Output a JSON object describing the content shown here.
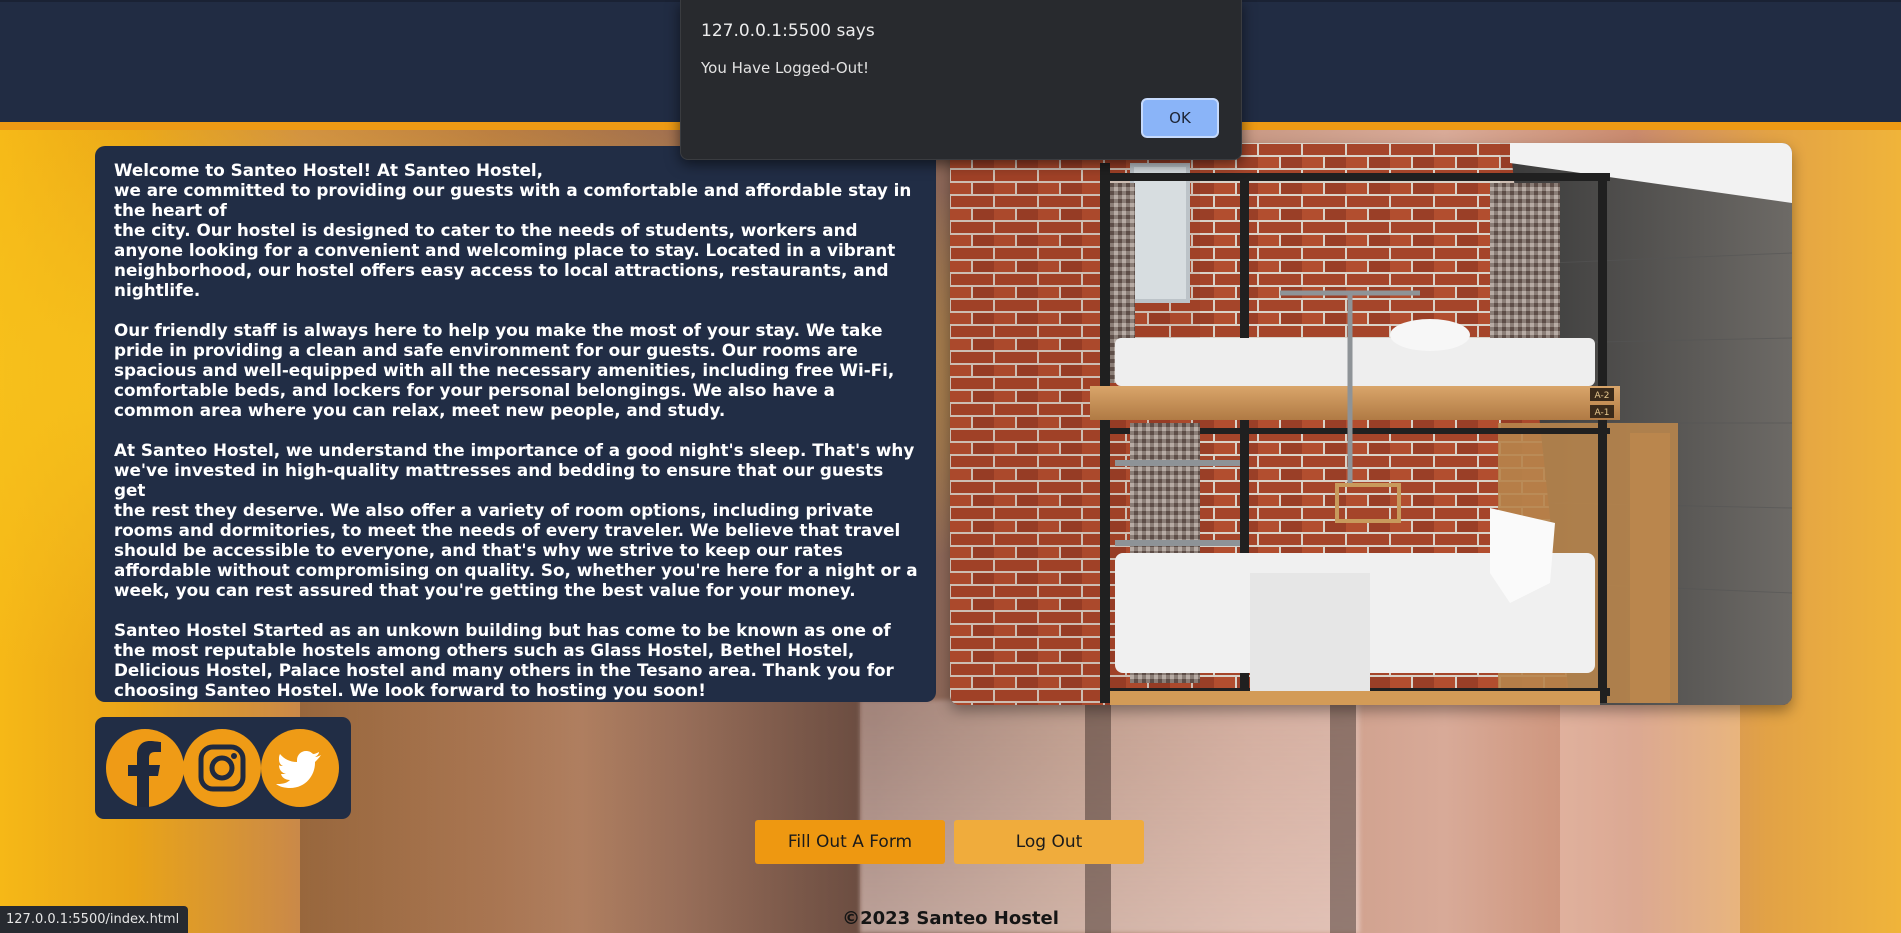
{
  "dialog": {
    "origin": "127.0.0.1:5500 says",
    "message": "You Have Logged-Out!",
    "ok_label": "OK"
  },
  "about": {
    "paragraphs": [
      {
        "lines": [
          "Welcome to Santeo Hostel! At Santeo Hostel,",
          "we are committed to providing our guests with a comfortable and affordable stay in",
          "the heart of",
          "the city. Our hostel is designed to cater to the needs of students, workers and",
          "anyone looking for a convenient and welcoming place to stay. Located in a vibrant",
          "neighborhood, our hostel offers easy access to local attractions, restaurants, and",
          "nightlife."
        ]
      },
      {
        "lines": [
          "Our friendly staff is always here to help you make the most of your stay. We take",
          "pride in providing a clean and safe environment for our guests. Our rooms are",
          "spacious and well-equipped with all the necessary amenities, including free Wi-Fi,",
          "comfortable beds, and lockers for your personal belongings. We also have a",
          "common area where you can relax, meet new people, and study."
        ]
      },
      {
        "lines": [
          "At Santeo Hostel, we understand the importance of a good night's sleep. That's why",
          "we've invested in high-quality mattresses and bedding to ensure that our guests get",
          "the rest they deserve. We also offer a variety of room options, including private",
          "rooms and dormitories, to meet the needs of every traveler. We believe that travel",
          "should be accessible to everyone, and that's why we strive to keep our rates",
          "affordable without compromising on quality. So, whether you're here for a night or a",
          "week, you can rest assured that you're getting the best value for your money."
        ]
      },
      {
        "lines": [
          "Santeo Hostel Started as an unkown building but has come to be known as one of",
          "the most reputable hostels among others such as Glass Hostel, Bethel Hostel,",
          "Delicious Hostel, Palace hostel and many others in the Tesano area. Thank you for",
          "choosing Santeo Hostel. We look forward to hosting you soon!"
        ]
      }
    ]
  },
  "photo": {
    "bunk_labels": [
      "A-2",
      "A-1"
    ]
  },
  "social": {
    "icons": [
      "facebook-icon",
      "instagram-icon",
      "twitter-icon"
    ]
  },
  "actions": {
    "form_label": "Fill Out A Form",
    "logout_label": "Log Out"
  },
  "footer": {
    "text": "©2023 Santeo Hostel"
  },
  "status_bar": {
    "url": "127.0.0.1:5500/index.html"
  },
  "colors": {
    "navy": "#212d45",
    "accent_orange": "#ee9a14",
    "dialog_button": "#8ab4f8"
  }
}
